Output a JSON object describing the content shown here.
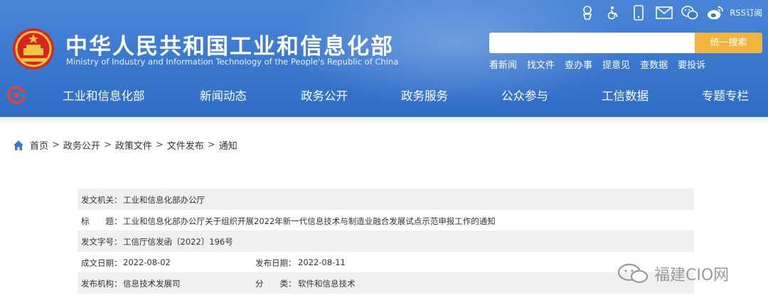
{
  "header": {
    "title": "中华人民共和国工业和信息化部",
    "subtitle": "Ministry of Industry and Information Technology of the People's Republic of China",
    "rss_label": "RSS订阅",
    "search_button": "统一搜索",
    "search_value": "",
    "quick_links": [
      "看新闻",
      "找文件",
      "查办事",
      "提意见",
      "查数据",
      "要投诉"
    ]
  },
  "nav": {
    "items": [
      "工业和信息化部",
      "新闻动态",
      "政务公开",
      "政务服务",
      "公众参与",
      "工信数据",
      "专题专栏"
    ]
  },
  "breadcrumb": [
    "首页",
    "政务公开",
    "政策文件",
    "文件发布",
    "通知"
  ],
  "breadcrumb_sep": ">",
  "document": {
    "issuer_label": "发文机关：",
    "issuer": "工业和信息化部办公厅",
    "title_label": "标　　题：",
    "title": "工业和信息化部办公厅关于组织开展2022年新一代信息技术与制造业融合发展试点示范申报工作的通知",
    "doc_no_label": "发文字号：",
    "doc_no": "工信厅信发函〔2022〕196号",
    "date_label": "成文日期：",
    "date": "2022-08-02",
    "publish_label": "发布日期：",
    "publish": "2022-08-11",
    "org_label": "发布机构：",
    "org": "信息技术发展司",
    "category_label": "分　　类：",
    "category": "软件和信息技术"
  },
  "watermark": "福建CIO网",
  "colors": {
    "header_blue": "#3a78cf",
    "search_button": "#f1b43c",
    "row_gray": "#eef0f2"
  },
  "icons": [
    "accessibility-elder-icon",
    "wheelchair-icon",
    "mobile-icon",
    "mail-icon",
    "wechat-icon",
    "weibo-icon",
    "home-icon",
    "national-emblem-icon",
    "wechat-watermark-icon"
  ]
}
